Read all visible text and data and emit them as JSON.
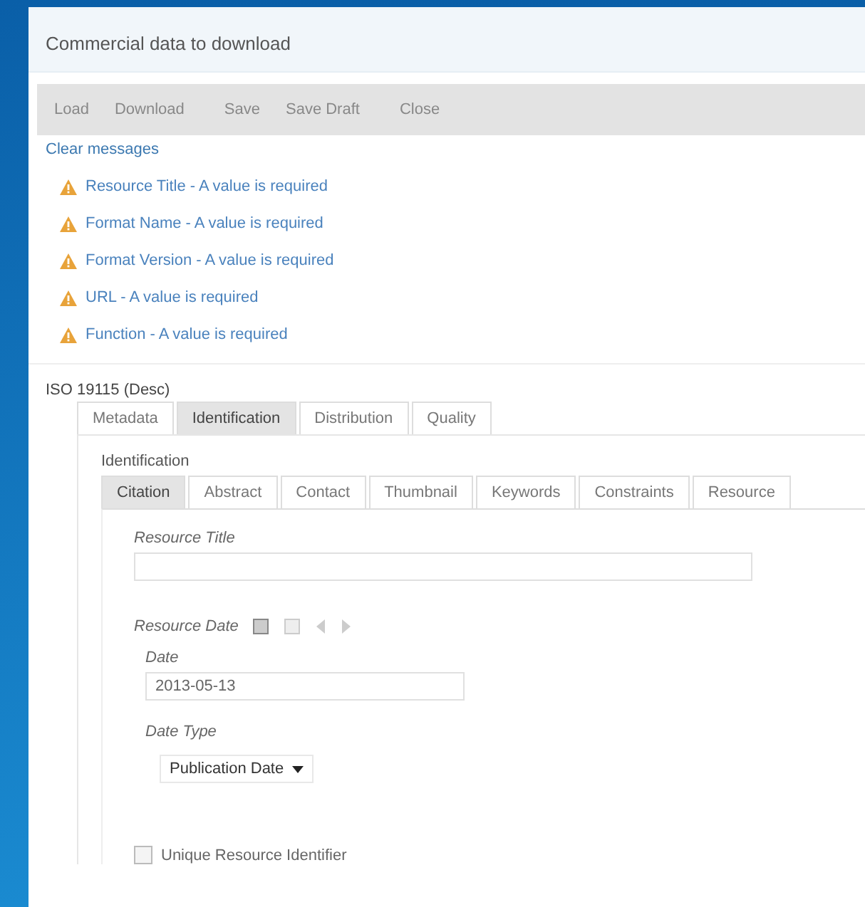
{
  "window": {
    "title": "Commercial data to download"
  },
  "toolbar": {
    "buttons": [
      "Load",
      "Download",
      "Save",
      "Save Draft",
      "Close"
    ]
  },
  "clear_messages": "Clear messages",
  "messages": [
    {
      "text": "Resource Title - A value is required"
    },
    {
      "text": "Format Name - A value is required"
    },
    {
      "text": "Format Version - A value is required"
    },
    {
      "text": "URL - A value is required"
    },
    {
      "text": "Function - A value is required"
    }
  ],
  "editor": {
    "title": "ISO 19115 (Desc)",
    "tabs": [
      {
        "label": "Metadata",
        "selected": false
      },
      {
        "label": "Identification",
        "selected": true
      },
      {
        "label": "Distribution",
        "selected": false
      },
      {
        "label": "Quality",
        "selected": false
      }
    ],
    "section": "Identification",
    "subtabs": [
      {
        "label": "Citation",
        "selected": true
      },
      {
        "label": "Abstract",
        "selected": false
      },
      {
        "label": "Contact",
        "selected": false
      },
      {
        "label": "Thumbnail",
        "selected": false
      },
      {
        "label": "Keywords",
        "selected": false
      },
      {
        "label": "Constraints",
        "selected": false
      },
      {
        "label": "Resource",
        "selected": false
      }
    ],
    "resource_title": {
      "label": "Resource Title"
    },
    "resource_date": {
      "label": "Resource Date",
      "date_label": "Date",
      "date_value": "2013-05-13",
      "type_label": "Date Type",
      "type_value": "Publication Date"
    },
    "unique_identifier": {
      "label": "Unique Resource Identifier",
      "checked": false
    }
  }
}
